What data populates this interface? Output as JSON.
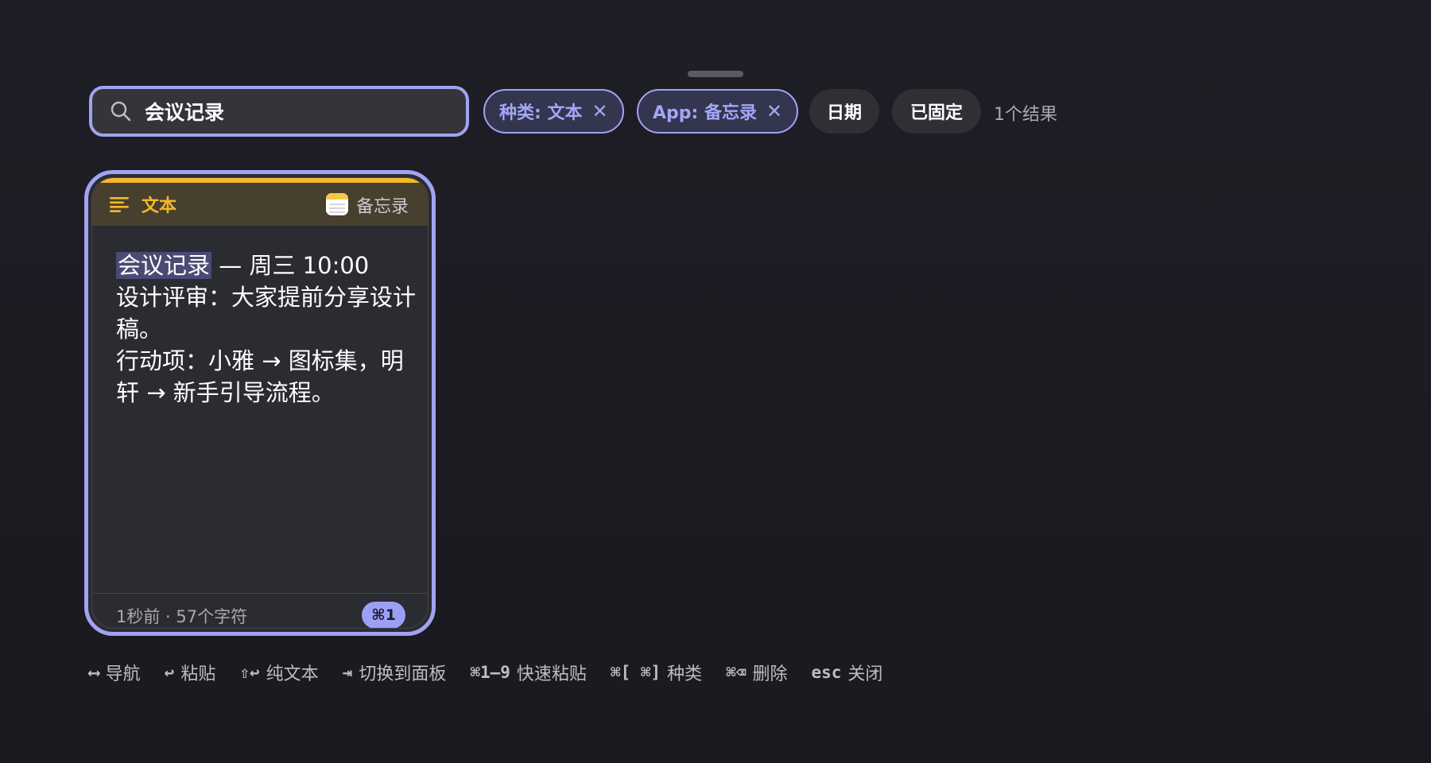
{
  "search": {
    "value": "会议记录",
    "icon": "search-icon"
  },
  "filters": {
    "active": [
      {
        "label": "种类: 文本",
        "remove": "✕"
      },
      {
        "label": "App: 备忘录",
        "remove": "✕"
      }
    ],
    "inactive": [
      {
        "label": "日期"
      },
      {
        "label": "已固定"
      }
    ],
    "result_count": "1个结果"
  },
  "colors": {
    "accent": "#a1a3f1",
    "type_text": "#f6b82a",
    "background": "#1f1e26"
  },
  "card": {
    "type_icon": "text-lines-icon",
    "type_label": "文本",
    "app_icon": "notes-app-icon",
    "app_label": "备忘录",
    "highlight": "会议记录",
    "content_rest": " — 周三 10:00\n设计评审：大家提前分享设计稿。\n行动项：小雅 → 图标集，明轩 → 新手引导流程。",
    "meta": "1秒前 · 57个字符",
    "shortcut": "⌘1"
  },
  "hints": [
    {
      "key": "⟷",
      "label": "导航"
    },
    {
      "key": "↩",
      "label": "粘贴"
    },
    {
      "key": "⇧↩",
      "label": "纯文本"
    },
    {
      "key": "⇥",
      "label": "切换到面板"
    },
    {
      "key": "⌘1–9",
      "label": "快速粘贴"
    },
    {
      "key": "⌘[ ⌘]",
      "label": "种类"
    },
    {
      "key": "⌘⌫",
      "label": "删除"
    },
    {
      "key": "esc",
      "label": "关闭"
    }
  ]
}
